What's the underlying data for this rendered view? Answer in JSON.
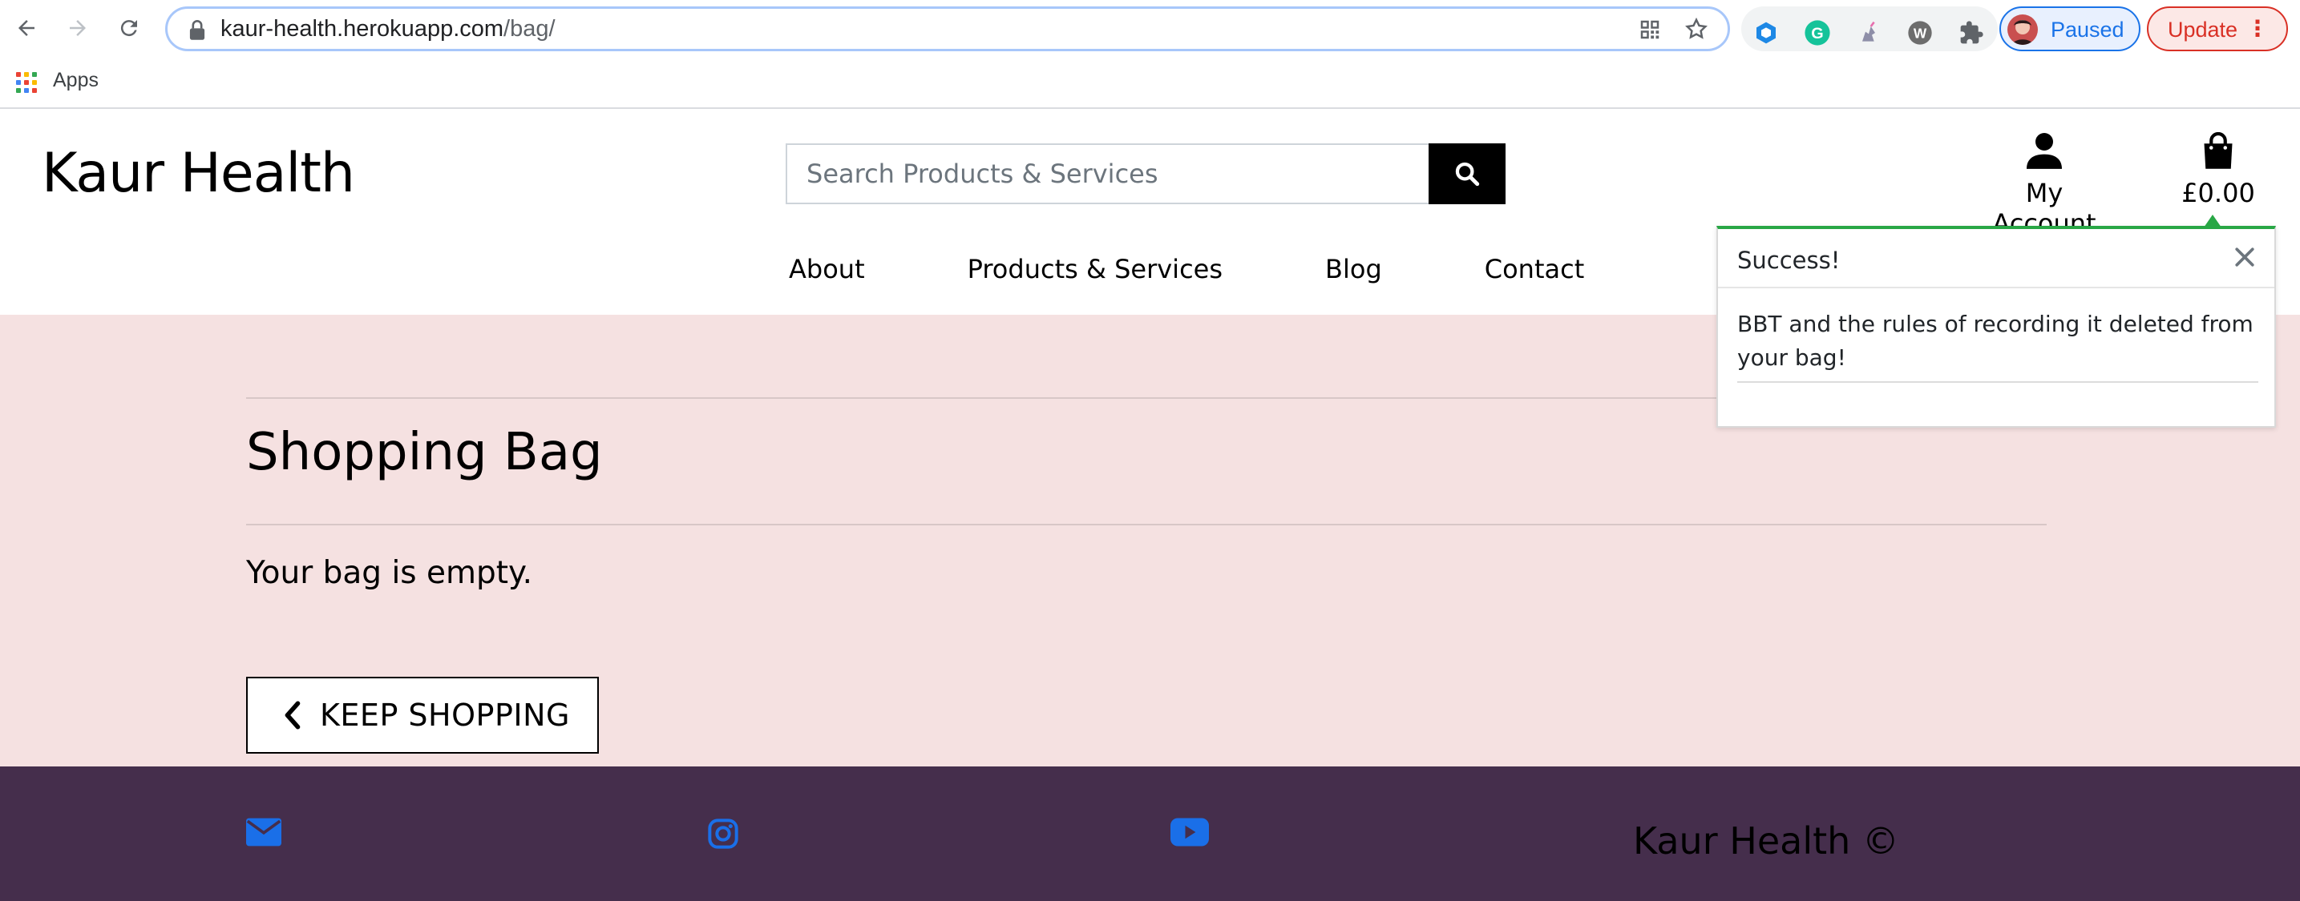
{
  "browser": {
    "url_host": "kaur-health.herokuapp.com",
    "url_path": "/bag/",
    "profile_label": "Paused",
    "update_label": "Update",
    "bookmarks": {
      "apps_label": "Apps"
    }
  },
  "header": {
    "logo": "Kaur Health",
    "search": {
      "placeholder": "Search Products & Services"
    },
    "account_label": "My Account",
    "bag_total": "£0.00",
    "nav": [
      "About",
      "Products & Services",
      "Blog",
      "Contact"
    ]
  },
  "toast": {
    "title": "Success!",
    "message": "BBT and the rules of recording it deleted from your bag!",
    "accent_color": "#28a745"
  },
  "main": {
    "title": "Shopping Bag",
    "empty_message": "Your bag is empty.",
    "keep_shopping_label": "KEEP SHOPPING",
    "background_color": "#f5e1e1"
  },
  "footer": {
    "copyright": "Kaur Health ©",
    "icons": [
      "envelope-icon",
      "instagram-icon",
      "youtube-icon"
    ],
    "background_color": "#452e4c",
    "icon_color": "#1a6fe8"
  }
}
